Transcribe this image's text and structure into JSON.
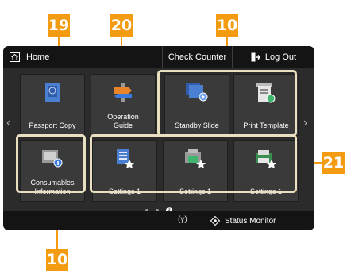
{
  "header": {
    "home": "Home",
    "check_counter": "Check Counter",
    "log_out": "Log Out"
  },
  "tiles": [
    {
      "label": "Passport Copy",
      "icon": "passport-icon"
    },
    {
      "label": "Operation Guide",
      "icon": "operation-guide-icon"
    },
    {
      "label": "Standby Slide",
      "icon": "standby-slide-icon"
    },
    {
      "label": "Print Template",
      "icon": "print-template-icon"
    },
    {
      "label": "Consumables Information",
      "icon": "consumables-icon"
    },
    {
      "label": "Settings 1",
      "icon": "settings-icon-1"
    },
    {
      "label": "Settings 1",
      "icon": "settings-icon-2"
    },
    {
      "label": "Settings 1",
      "icon": "settings-icon-3"
    }
  ],
  "pagination": {
    "active_index": "3"
  },
  "footer": {
    "status_monitor": "Status Monitor",
    "network": "(ɣ)"
  },
  "callouts": [
    "19",
    "20",
    "10",
    "10",
    "21"
  ],
  "colors": {
    "badge": "#f39c12",
    "screen": "#2b2b2b",
    "highlight": "#e8e0c0"
  }
}
